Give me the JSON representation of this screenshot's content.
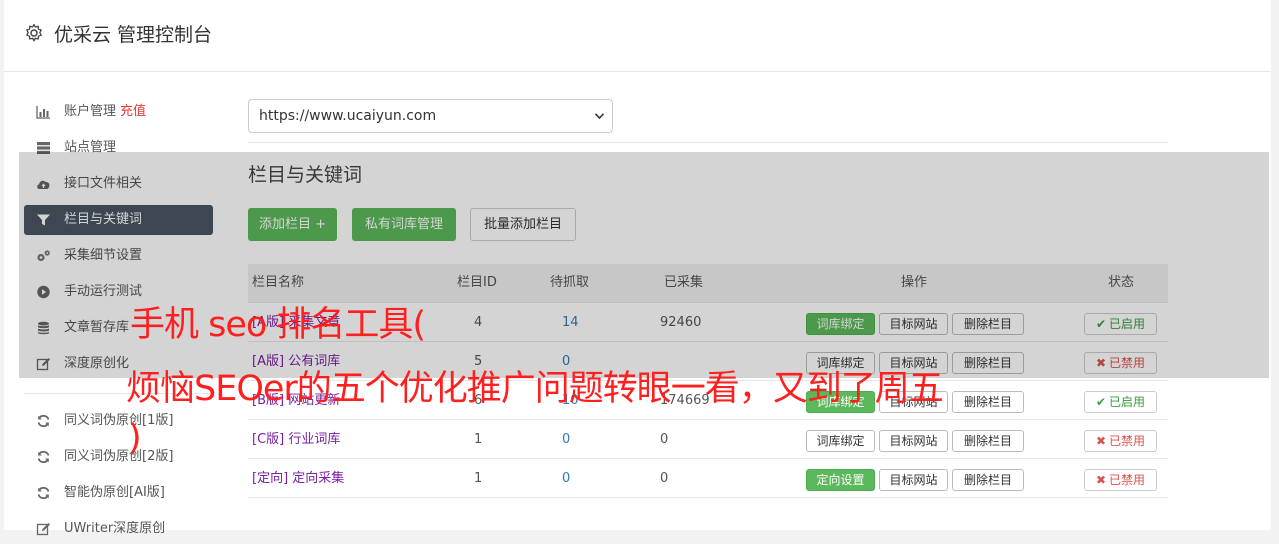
{
  "header": {
    "title": "优采云 管理控制台",
    "icon": "gear-icon"
  },
  "sidebar": {
    "items": [
      {
        "label": "账户管理",
        "extra": "充值",
        "icon": "bar-chart-icon"
      },
      {
        "label": "站点管理",
        "icon": "server-icon"
      },
      {
        "label": "接口文件相关",
        "icon": "cloud-upload-icon"
      },
      {
        "label": "栏目与关键词",
        "icon": "filter-icon",
        "active": true
      },
      {
        "label": "采集细节设置",
        "icon": "cogs-icon"
      },
      {
        "label": "手动运行测试",
        "icon": "play-circle-icon"
      },
      {
        "label": "文章暂存库",
        "icon": "database-icon"
      },
      {
        "label": "深度原创化",
        "icon": "edit-icon"
      },
      {
        "label": "同义词伪原创[1版]",
        "icon": "refresh-icon"
      },
      {
        "label": "同义词伪原创[2版]",
        "icon": "refresh-icon"
      },
      {
        "label": "智能伪原创[AI版]",
        "icon": "refresh-icon"
      },
      {
        "label": "UWriter深度原创",
        "icon": "edit-icon"
      }
    ]
  },
  "main": {
    "site_select": "https://www.ucaiyun.com",
    "section_title": "栏目与关键词",
    "buttons": {
      "add_column": "添加栏目 +",
      "private_lib": "私有词库管理",
      "batch_add": "批量添加栏目"
    },
    "table": {
      "headers": {
        "name": "栏目名称",
        "id": "栏目ID",
        "pending": "待抓取",
        "collected": "已采集",
        "ops": "操作",
        "status": "状态"
      },
      "rows": [
        {
          "type": "[A版]",
          "name": "采集文章",
          "id": "4",
          "pending": "14",
          "collected": "92460",
          "op1": "词库绑定",
          "op2": "目标网站",
          "op3": "删除栏目",
          "status": "已启用",
          "enabled": true
        },
        {
          "type": "[A版]",
          "name": "公有词库",
          "id": "5",
          "pending": "0",
          "collected": "",
          "op1": "词库绑定",
          "op2": "目标网站",
          "op3": "删除栏目",
          "status": "已禁用",
          "enabled": false
        },
        {
          "type": "[B版]",
          "name": "网站更新",
          "id": "6",
          "pending": "10",
          "collected": "174669",
          "op1": "词库绑定",
          "op2": "目标网站",
          "op3": "删除栏目",
          "status": "已启用",
          "enabled": true
        },
        {
          "type": "[C版]",
          "name": "行业词库",
          "id": "1",
          "pending": "0",
          "collected": "0",
          "op1": "词库绑定",
          "op2": "目标网站",
          "op3": "删除栏目",
          "status": "已禁用",
          "enabled": false
        },
        {
          "type": "[定向]",
          "name": "定向采集",
          "id": "1",
          "pending": "0",
          "collected": "0",
          "op1": "定向设置",
          "op2": "目标网站",
          "op3": "删除栏目",
          "status": "已禁用",
          "enabled": false
        }
      ]
    }
  },
  "overlay_caption": {
    "line1": "手机 seo 排名工具(",
    "line2": "烦恼SEOer的五个优化推广问题转眼一看，又到了周五",
    "line3": ")"
  },
  "colors": {
    "accent_green": "#5cb85c",
    "sidebar_active": "#4a5663",
    "caption_red": "#ff1f1f",
    "link_blue": "#337ab7"
  }
}
